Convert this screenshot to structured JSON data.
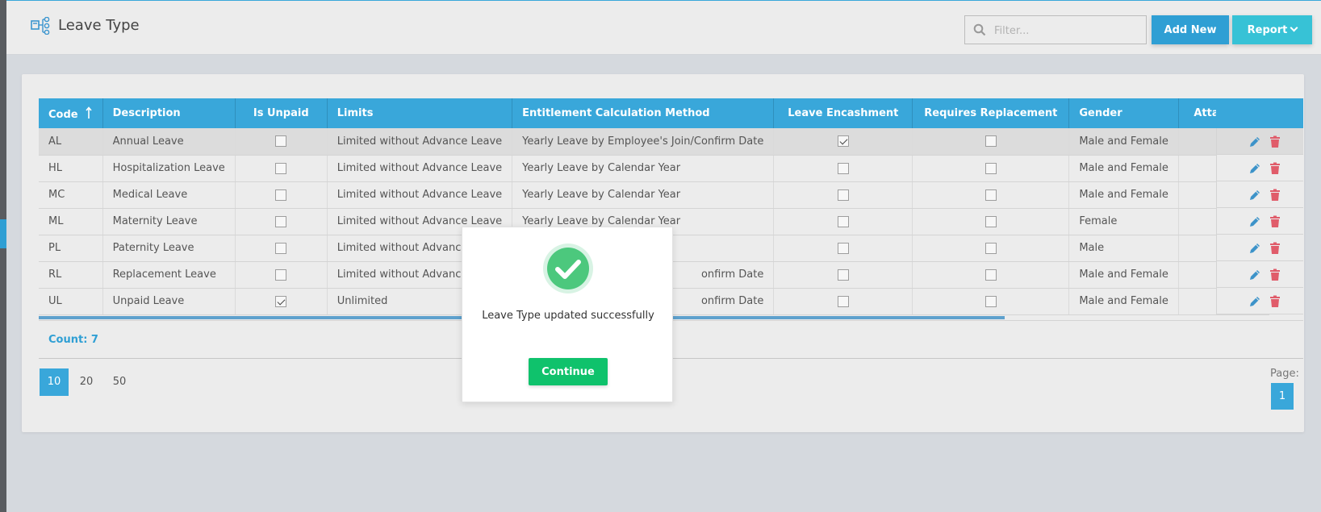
{
  "header": {
    "title": "Leave Type",
    "search_placeholder": "Filter...",
    "add_new_label": "Add New",
    "report_label": "Report"
  },
  "table": {
    "columns": [
      "Code",
      "Description",
      "Is Unpaid",
      "Limits",
      "Entitlement Calculation Method",
      "Leave Encashment",
      "Requires Replacement",
      "Gender",
      "Attachment"
    ],
    "rows": [
      {
        "code": "AL",
        "description": "Annual Leave",
        "is_unpaid": false,
        "limits": "Limited without Advance Leave",
        "method": "Yearly Leave by Employee's Join/Confirm Date",
        "encashment": true,
        "replacement": false,
        "gender": "Male and Female",
        "attachment": false,
        "selected": true
      },
      {
        "code": "HL",
        "description": "Hospitalization Leave",
        "is_unpaid": false,
        "limits": "Limited without Advance Leave",
        "method": "Yearly Leave by Calendar Year",
        "encashment": false,
        "replacement": false,
        "gender": "Male and Female",
        "attachment": false,
        "selected": false
      },
      {
        "code": "MC",
        "description": "Medical Leave",
        "is_unpaid": false,
        "limits": "Limited without Advance Leave",
        "method": "Yearly Leave by Calendar Year",
        "encashment": false,
        "replacement": false,
        "gender": "Male and Female",
        "attachment": false,
        "selected": false
      },
      {
        "code": "ML",
        "description": "Maternity Leave",
        "is_unpaid": false,
        "limits": "Limited without Advance Leave",
        "method": "Yearly Leave by Calendar Year",
        "encashment": false,
        "replacement": false,
        "gender": "Female",
        "attachment": false,
        "selected": false
      },
      {
        "code": "PL",
        "description": "Paternity Leave",
        "is_unpaid": false,
        "limits": "Limited without Advance Le",
        "method": "",
        "encashment": false,
        "replacement": false,
        "gender": "Male",
        "attachment": false,
        "selected": false
      },
      {
        "code": "RL",
        "description": "Replacement Leave",
        "is_unpaid": false,
        "limits": "Limited without Advance Le",
        "method": "onfirm Date",
        "encashment": false,
        "replacement": false,
        "gender": "Male and Female",
        "attachment": false,
        "selected": false
      },
      {
        "code": "UL",
        "description": "Unpaid Leave",
        "is_unpaid": true,
        "limits": "Unlimited",
        "method": "onfirm Date",
        "encashment": false,
        "replacement": false,
        "gender": "Male and Female",
        "attachment": false,
        "selected": false
      }
    ],
    "count_label": "Count: 7"
  },
  "pagination": {
    "page_sizes": [
      "10",
      "20",
      "50"
    ],
    "active_size": "10",
    "page_label": "Page:",
    "current_page": "1"
  },
  "modal": {
    "message": "Leave Type updated successfully",
    "continue_label": "Continue"
  },
  "colors": {
    "accent": "#39a7da",
    "success": "#0fc26c",
    "danger": "#e05c6a",
    "report": "#37c2d6"
  }
}
